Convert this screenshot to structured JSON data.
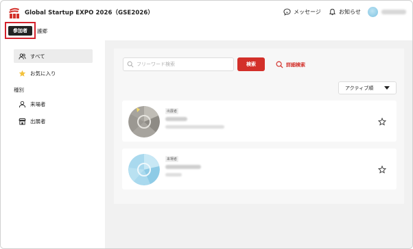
{
  "app": {
    "title": "Global Startup EXPO 2026（GSE2026）",
    "logo_icon": "expo-logo-icon"
  },
  "header": {
    "messages_label": "メッセージ",
    "notices_label": "お知らせ",
    "messages_icon": "chat-bubble-icon",
    "notices_icon": "bell-icon"
  },
  "role_tabs": {
    "active": "参加者",
    "other": "護郷"
  },
  "sidebar": {
    "items": [
      {
        "label": "すべて",
        "icon": "people-icon",
        "active": true
      },
      {
        "label": "お気に入り",
        "icon": "star-filled-icon",
        "active": false
      }
    ],
    "type_heading": "種別",
    "type_items": [
      {
        "label": "来場者",
        "icon": "person-icon"
      },
      {
        "label": "出展者",
        "icon": "storefront-icon"
      }
    ]
  },
  "search": {
    "placeholder": "フリーワード検索",
    "value": "",
    "button_label": "検索",
    "advanced_label": "詳細検索"
  },
  "sort": {
    "selected": "アクティブ順"
  },
  "cards": [
    {
      "tag": "出展者"
    },
    {
      "tag": "来場者"
    }
  ],
  "colors": {
    "accent": "#d3302a",
    "highlight_border": "#d3202a",
    "main_bg": "#f1f1f1",
    "active_item_bg": "#ececec"
  }
}
